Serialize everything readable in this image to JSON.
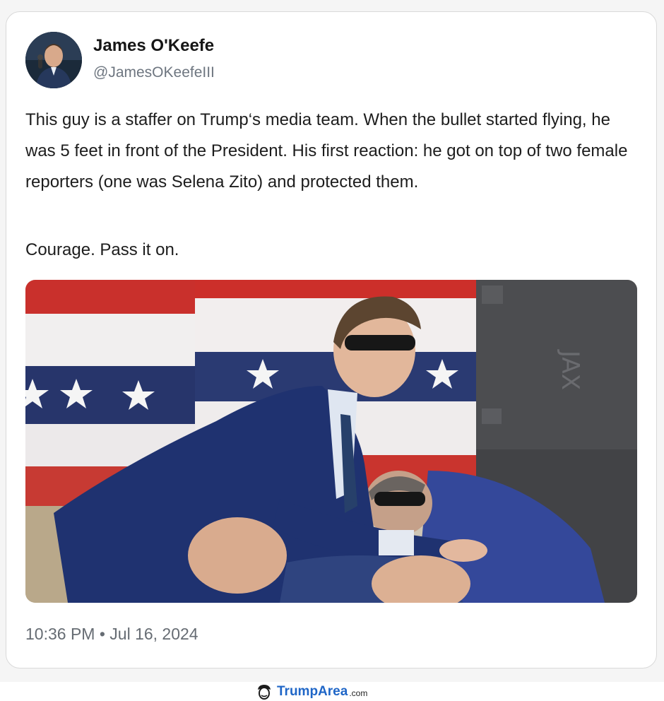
{
  "post": {
    "author_name": "James O'Keefe",
    "author_handle": "@JamesOKeefeIII",
    "body": "This guy is a staffer on Trump‘s media team. When the bullet started flying, he was 5 feet in front of the President. His first reaction: he got on top of two female reporters (one was Selena Zito) and protected them.",
    "tagline": "Courage. Pass it on.",
    "timestamp": "10:36 PM • Jul 16, 2024"
  },
  "footer": {
    "brand_name": "TrumpArea",
    "brand_tld": ".com"
  },
  "icons": {
    "avatar": "profile-photo",
    "brand": "trump-face-icon"
  },
  "colors": {
    "card_bg": "#ffffff",
    "text": "#1d1d1d",
    "muted": "#6e7680",
    "brand": "#1f66c7"
  }
}
